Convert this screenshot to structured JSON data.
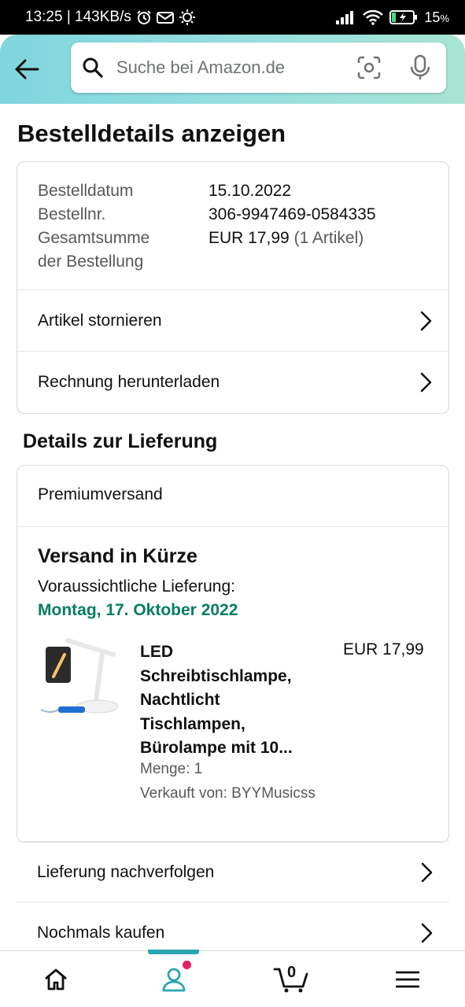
{
  "status_bar": {
    "time_speed": "13:25 | 143KB/s",
    "battery": "15",
    "battery_unit": "%"
  },
  "search": {
    "placeholder": "Suche bei Amazon.de"
  },
  "page": {
    "title": "Bestelldetails anzeigen"
  },
  "order_summary": {
    "date_label": "Bestelldatum",
    "date_value": "15.10.2022",
    "number_label": "Bestellnr.",
    "number_value": "306-9947469-0584335",
    "total_label_line1": "Gesamtsumme",
    "total_label_line2": "der Bestellung",
    "total_value": "EUR 17,99",
    "total_items": "(1 Artikel)"
  },
  "order_actions": [
    {
      "label": "Artikel stornieren"
    },
    {
      "label": "Rechnung herunterladen"
    }
  ],
  "delivery": {
    "section_title": "Details zur Lieferung",
    "shipping_method": "Premiumversand",
    "status_title": "Versand in Kürze",
    "expected_label": "Voraussichtliche Lieferung:",
    "expected_date": "Montag, 17. Oktober 2022",
    "item": {
      "title": "LED Schreibtischlampe, Nachtlicht Tischlampen, Bürolampe mit 10...",
      "price": "EUR 17,99",
      "quantity": "Menge: 1",
      "seller": "Verkauft von: BYYMusicss"
    }
  },
  "delivery_actions": [
    {
      "label": "Lieferung nachverfolgen"
    },
    {
      "label": "Nochmals kaufen"
    }
  ],
  "bottom_nav": {
    "cart_count": "0",
    "active": "account"
  },
  "colors": {
    "accent_teal": "#2aa6b0",
    "delivery_green": "#067d62",
    "notification_pink": "#e3205f"
  }
}
